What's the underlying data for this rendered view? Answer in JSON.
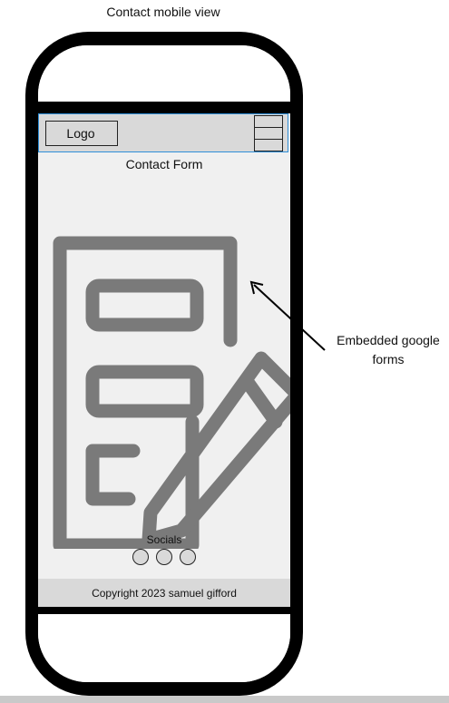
{
  "page_title": "Contact mobile view",
  "header": {
    "logo_label": "Logo"
  },
  "contact_form_title": "Contact Form",
  "socials": {
    "label": "Socials",
    "icons": [
      "social-icon",
      "social-icon",
      "social-icon"
    ]
  },
  "footer": {
    "copyright": "Copyright 2023 samuel gifford"
  },
  "annotation": {
    "line1": "Embedded google",
    "line2": "forms"
  },
  "colors": {
    "phone_frame": "#000000",
    "content_bg": "#f0f0f0",
    "bar_fill": "#d9d9d9",
    "header_outline": "#2f8fd8",
    "illustration": "#7a7a7a"
  },
  "icons": {
    "menu": "hamburger-icon",
    "illustration": "form-with-pencil-icon",
    "annotation_arrow": "arrow-icon"
  }
}
